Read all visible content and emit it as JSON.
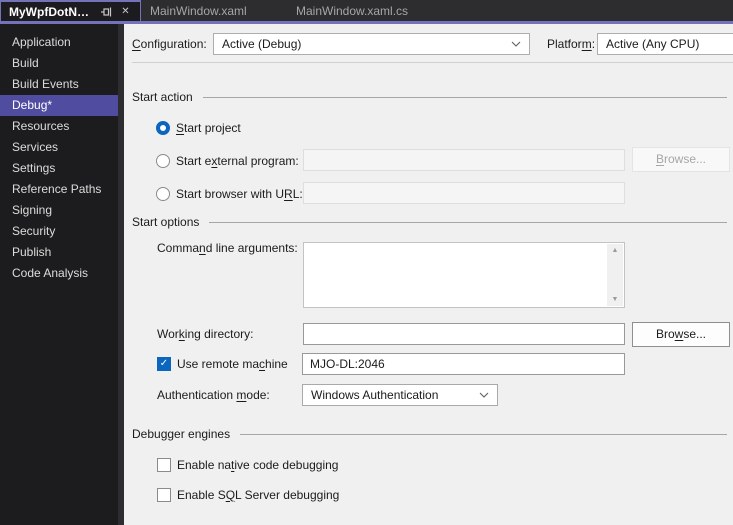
{
  "tabs": {
    "active": {
      "label": "MyWpfDotNetF*"
    },
    "tab2": {
      "label": "MainWindow.xaml"
    },
    "tab3": {
      "label": "MainWindow.xaml.cs"
    },
    "close_glyph": "✕"
  },
  "sidebar": {
    "items": [
      "Application",
      "Build",
      "Build Events",
      "Debug*",
      "Resources",
      "Services",
      "Settings",
      "Reference Paths",
      "Signing",
      "Security",
      "Publish",
      "Code Analysis"
    ],
    "selected": "Debug*"
  },
  "config_row": {
    "configuration_label": {
      "pre": "",
      "key": "C",
      "post": "onfiguration:"
    },
    "configuration_value": "Active (Debug)",
    "platform_label": {
      "pre": "Platfor",
      "key": "m",
      "post": ":"
    },
    "platform_value": "Active (Any CPU)"
  },
  "start_action": {
    "title": "Start action",
    "radio_project": {
      "pre": "",
      "key": "S",
      "post": "tart project"
    },
    "radio_external": {
      "pre": "Start e",
      "key": "x",
      "post": "ternal program:"
    },
    "radio_browser": {
      "pre": "Start browser with U",
      "key": "R",
      "post": "L:"
    },
    "browse_button": {
      "pre": "",
      "key": "B",
      "post": "rowse..."
    },
    "external_value": "",
    "browser_url_value": ""
  },
  "start_options": {
    "title": "Start options",
    "cmd_label": {
      "pre": "Comma",
      "key": "n",
      "post": "d line arguments:"
    },
    "cmd_value": "",
    "workdir_label": {
      "pre": "Wor",
      "key": "k",
      "post": "ing directory:"
    },
    "workdir_value": "",
    "browse_button": {
      "pre": "Bro",
      "key": "w",
      "post": "se..."
    },
    "remote_label": {
      "pre": "Use remote ma",
      "key": "c",
      "post": "hine"
    },
    "remote_checked": true,
    "remote_value": "MJO-DL:2046",
    "auth_label": {
      "pre": "Authentication ",
      "key": "m",
      "post": "ode:"
    },
    "auth_value": "Windows Authentication"
  },
  "debugger_engines": {
    "title": "Debugger engines",
    "native_label": {
      "pre": "Enable na",
      "key": "t",
      "post": "ive code debugging"
    },
    "native_checked": false,
    "sql_label": {
      "pre": "Enable S",
      "key": "Q",
      "post": "L Server debugging"
    },
    "sql_checked": false
  },
  "glyphs": {
    "check": "✓",
    "scroll_up": "▲",
    "scroll_down": "▼"
  },
  "colors": {
    "accent_purple": "#7472b8",
    "sidebar_selection": "#504da0",
    "control_blue": "#0a66bf",
    "tabbar_bg": "#2d2d30",
    "sidebar_bg": "#1c1c1e",
    "content_bg": "#f0f0f0"
  }
}
